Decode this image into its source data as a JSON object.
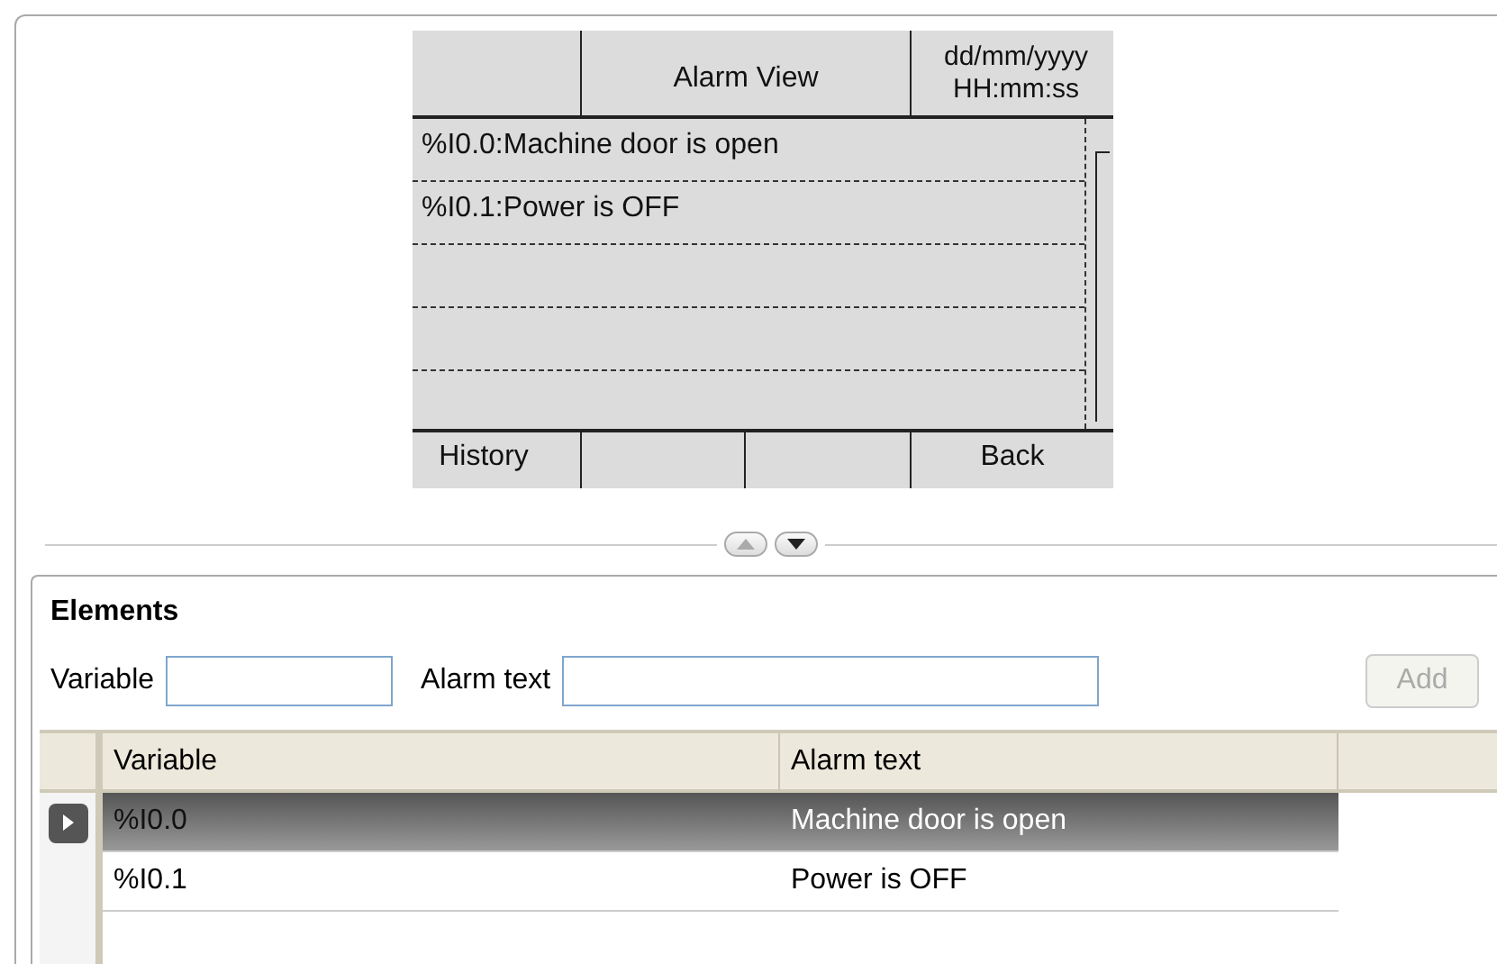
{
  "preview": {
    "title": "Alarm View",
    "datetime": "dd/mm/yyyy HH:mm:ss",
    "alarms": [
      "%I0.0:Machine door is open",
      "%I0.1:Power is OFF"
    ],
    "left_softkey": "History",
    "right_softkey": "Back"
  },
  "splitter": {
    "up_disabled": true,
    "down_disabled": false
  },
  "elements": {
    "title": "Elements",
    "fields": [
      {
        "label": "Variable"
      },
      {
        "label": "Alarm text"
      }
    ],
    "add_button": {
      "label": "Add",
      "disabled": true
    },
    "table": {
      "columns": [
        "Variable",
        "Alarm text"
      ],
      "rows": [
        {
          "cells": [
            "%I0.0",
            "Machine door is open"
          ],
          "selected": true
        },
        {
          "cells": [
            "%I0.1",
            "Power is OFF"
          ],
          "selected": false
        }
      ]
    }
  }
}
